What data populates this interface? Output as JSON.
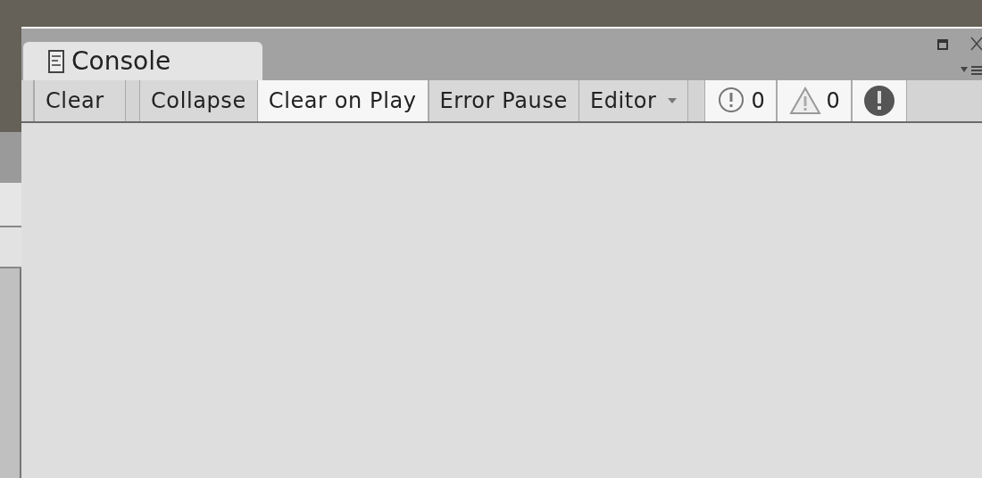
{
  "tab": {
    "title": "Console",
    "selected": true
  },
  "toolbar": [
    {
      "kind": "button",
      "label": "Clear"
    },
    {
      "kind": "toggle",
      "label": "Collapse",
      "on": false
    },
    {
      "kind": "toggle",
      "label": "Clear on Play",
      "on": true
    },
    {
      "kind": "toggle",
      "label": "Error Pause",
      "on": false
    },
    {
      "kind": "dropdown",
      "label": "Editor"
    },
    {
      "kind": "info_counter",
      "count": "0",
      "on": true
    },
    {
      "kind": "warning_counter",
      "count": "0",
      "on": true
    },
    {
      "kind": "error_counter",
      "on": true
    }
  ]
}
